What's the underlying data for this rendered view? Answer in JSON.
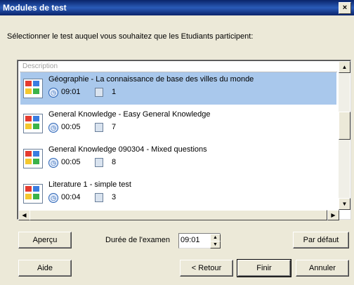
{
  "window": {
    "title": "Modules de test",
    "close_glyph": "×"
  },
  "instruction": "Sélectionner le test auquel vous souhaitez que les Etudiants participent:",
  "list": {
    "header": "Description",
    "items": [
      {
        "name": "Géographie - La connaissance de base des villes du monde",
        "time": "09:01",
        "count": "1",
        "selected": true
      },
      {
        "name": "General Knowledge - Easy General Knowledge",
        "time": "00:05",
        "count": "7",
        "selected": false
      },
      {
        "name": "General Knowledge 090304 - Mixed questions",
        "time": "00:05",
        "count": "8",
        "selected": false
      },
      {
        "name": "Literature 1 - simple test",
        "time": "00:04",
        "count": "3",
        "selected": false
      }
    ]
  },
  "controls": {
    "preview_label": "Aperçu",
    "duration_label": "Durée de l'examen",
    "duration_value": "09:01",
    "default_label": "Par défaut"
  },
  "footer": {
    "help_label": "Aide",
    "back_label": "< Retour",
    "finish_label": "Finir",
    "cancel_label": "Annuler"
  },
  "colors": {
    "selected_row": "#a9c8ec",
    "titlebar": "#0a246a"
  },
  "icons": {
    "item_icon": "test-module-icon",
    "time_icon": "clock-icon",
    "question_icon": "questions-icon"
  }
}
